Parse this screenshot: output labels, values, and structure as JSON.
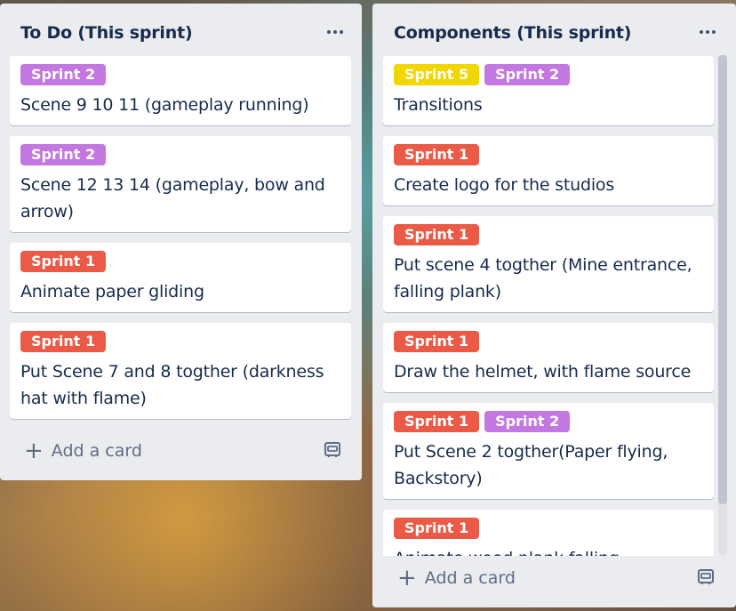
{
  "lists": [
    {
      "title": "To Do (This sprint)",
      "add_card_label": "Add a card",
      "cards": [
        {
          "labels": [
            {
              "text": "Sprint 2",
              "color": "#c377e0"
            }
          ],
          "title": "Scene 9 10 11 (gameplay running)"
        },
        {
          "labels": [
            {
              "text": "Sprint 2",
              "color": "#c377e0"
            }
          ],
          "title": "Scene 12 13 14 (gameplay, bow and arrow)"
        },
        {
          "labels": [
            {
              "text": "Sprint 1",
              "color": "#eb5a46"
            }
          ],
          "title": "Animate paper gliding"
        },
        {
          "labels": [
            {
              "text": "Sprint 1",
              "color": "#eb5a46"
            }
          ],
          "title": "Put Scene 7 and 8 togther (darkness hat with flame)"
        }
      ]
    },
    {
      "title": "Components (This sprint)",
      "add_card_label": "Add a card",
      "cards": [
        {
          "labels": [
            {
              "text": "Sprint 5",
              "color": "#f2d600"
            },
            {
              "text": "Sprint 2",
              "color": "#c377e0"
            }
          ],
          "title": "Transitions"
        },
        {
          "labels": [
            {
              "text": "Sprint 1",
              "color": "#eb5a46"
            }
          ],
          "title": "Create logo for the studios"
        },
        {
          "labels": [
            {
              "text": "Sprint 1",
              "color": "#eb5a46"
            }
          ],
          "title": "Put scene 4 togther (Mine entrance, falling plank)"
        },
        {
          "labels": [
            {
              "text": "Sprint 1",
              "color": "#eb5a46"
            }
          ],
          "title": "Draw the helmet, with flame source"
        },
        {
          "labels": [
            {
              "text": "Sprint 1",
              "color": "#eb5a46"
            },
            {
              "text": "Sprint 2",
              "color": "#c377e0"
            }
          ],
          "title": "Put Scene 2 togther(Paper flying, Backstory)"
        },
        {
          "labels": [
            {
              "text": "Sprint 1",
              "color": "#eb5a46"
            }
          ],
          "title": "Animate wood plank falling"
        }
      ]
    }
  ],
  "icons": {
    "list_menu": "ellipsis-icon",
    "add": "plus-icon",
    "template": "card-template-icon"
  },
  "colors": {
    "list_bg": "#ebecf0",
    "card_text": "#172b4d",
    "muted_text": "#5e6c84"
  }
}
